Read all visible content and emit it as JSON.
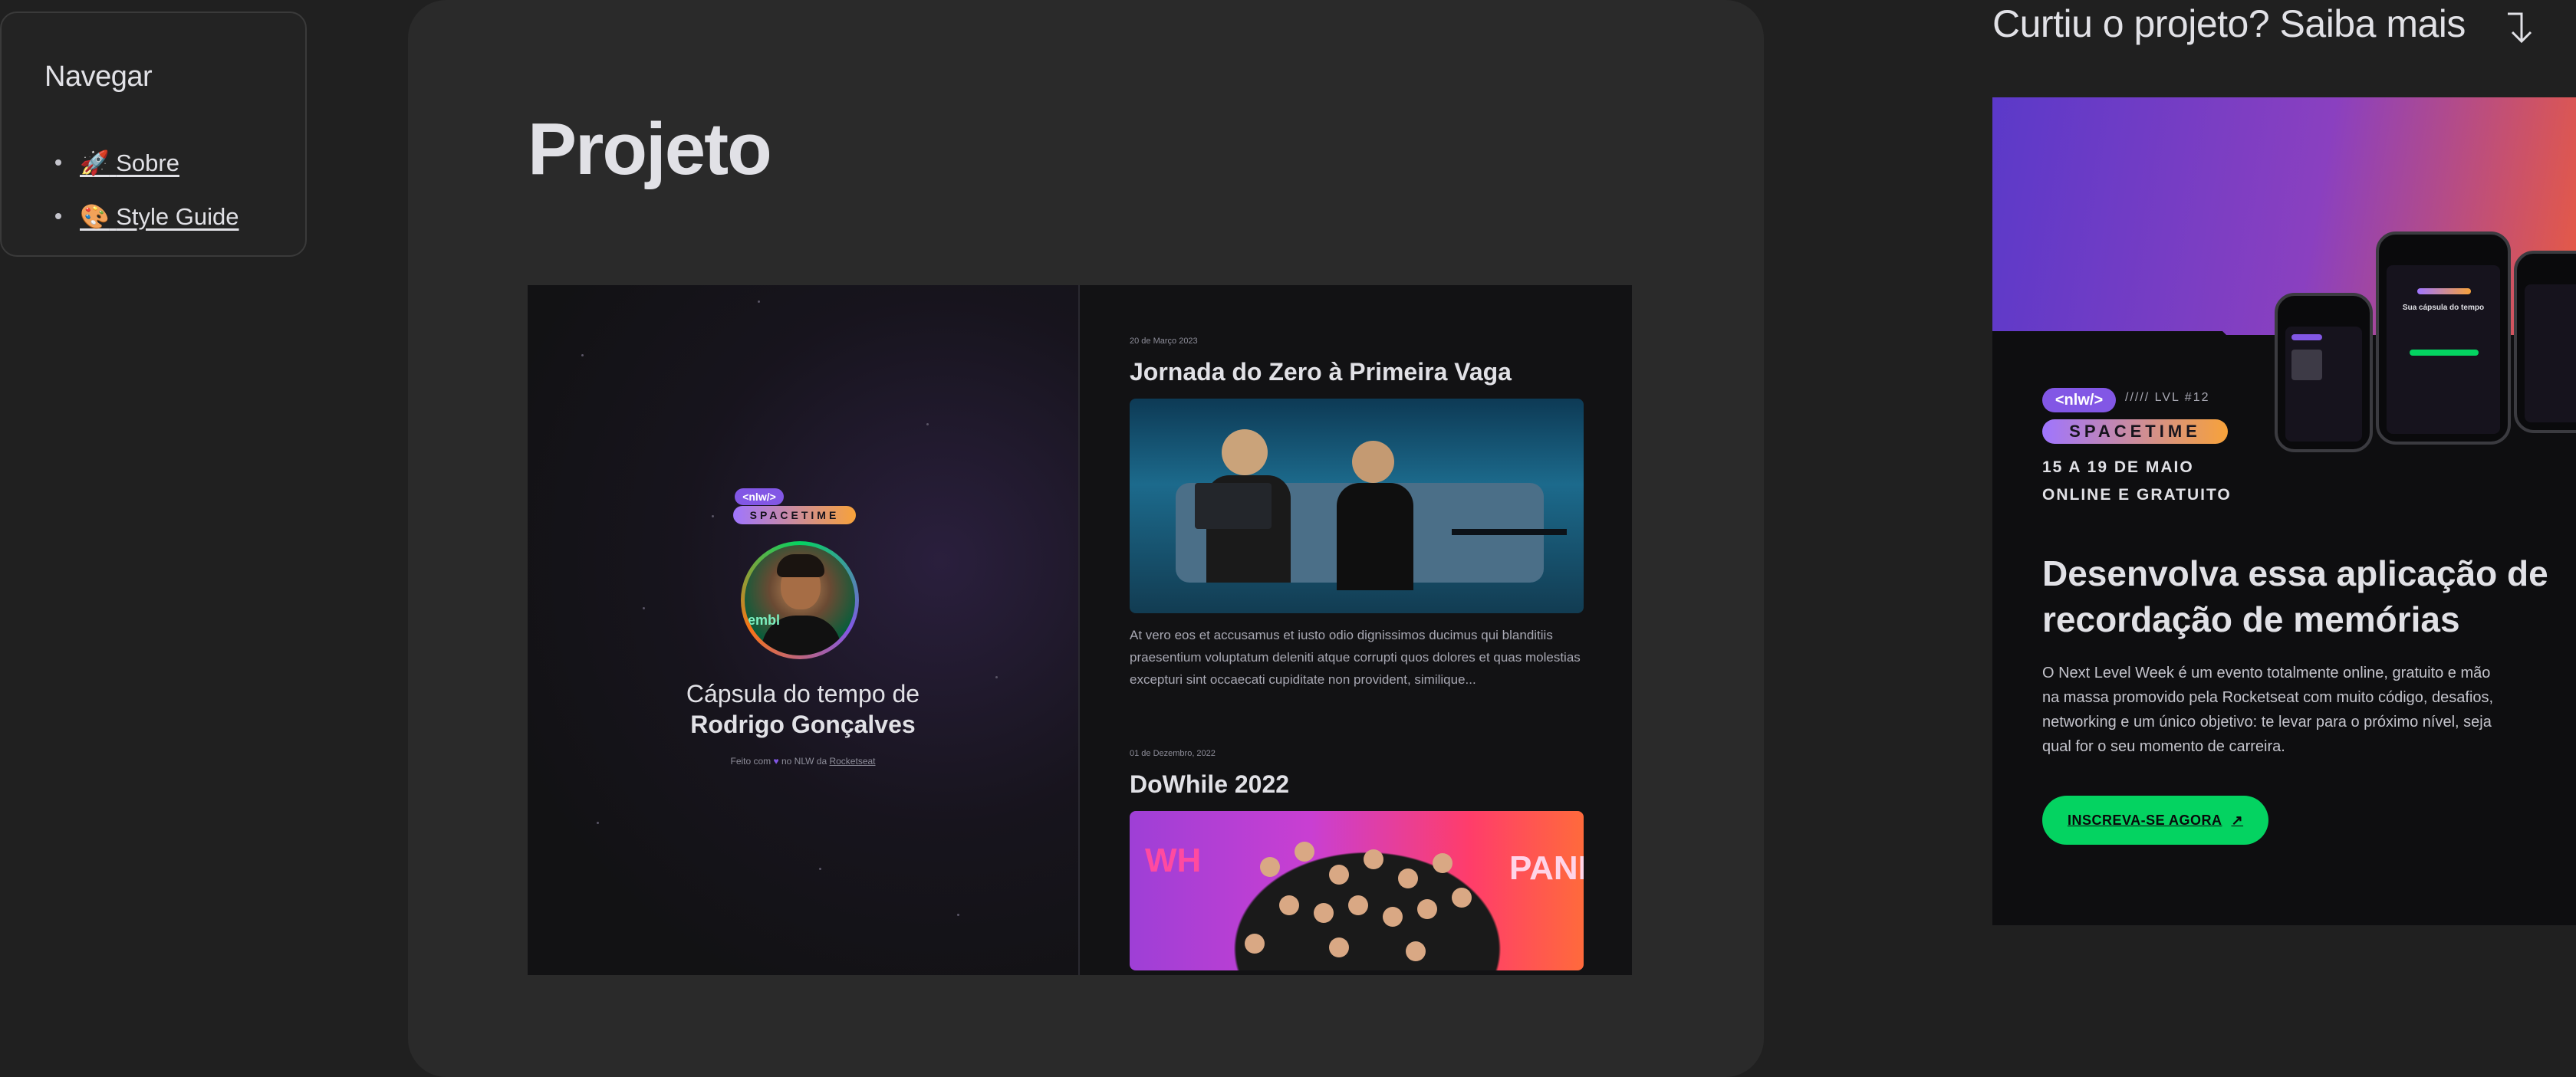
{
  "nav": {
    "title": "Navegar",
    "items": [
      {
        "emoji": "🚀",
        "label": "Sobre"
      },
      {
        "emoji": "🎨",
        "label": "Style Guide"
      }
    ]
  },
  "main": {
    "title": "Projeto"
  },
  "preview": {
    "brand_top": "<nlw/>",
    "brand_bottom": "SPACETIME",
    "avatar_text": "embl",
    "capsule_title": "Cápsula do tempo de",
    "capsule_name": "Rodrigo Gonçalves",
    "made_with_prefix": "Feito com",
    "made_with_heart": "♥",
    "made_with_mid": "no NLW da",
    "made_with_link": "Rocketseat",
    "posts": [
      {
        "date": "20 de Março 2023",
        "title": "Jornada do Zero à Primeira Vaga",
        "text": "At vero eos et accusamus et iusto odio dignissimos ducimus qui blanditiis praesentium voluptatum deleniti atque corrupti quos dolores et quas molestias excepturi sint occaecati cupiditate non provident, similique..."
      },
      {
        "date": "01 de Dezembro, 2022",
        "title": "DoWhile 2022",
        "img_left": "WH",
        "img_right": "PANI"
      }
    ]
  },
  "promo": {
    "heading": "Curtiu o projeto? Saiba mais",
    "badge_nlw": "<nlw/>",
    "badge_lvl": "///// LVL #12",
    "badge_spacetime": "SPACETIME",
    "date": "15 A 19 DE MAIO",
    "mode": "ONLINE E GRATUITO",
    "title": "Desenvolva essa aplicação de recordação de memórias",
    "description": "O Next Level Week é um evento totalmente online, gratuito e mão na massa promovido pela Rocketseat com muito código, desafios, networking e um único objetivo: te levar para o próximo nível, seja qual for o seu momento de carreira.",
    "cta": "INSCREVA-SE AGORA",
    "cta_icon": "↗",
    "phone_caption": "Sua cápsula do tempo"
  },
  "colors": {
    "accent_purple": "#8257e5",
    "accent_green": "#04d361",
    "background": "#202020",
    "panel": "#2a2a2a"
  }
}
